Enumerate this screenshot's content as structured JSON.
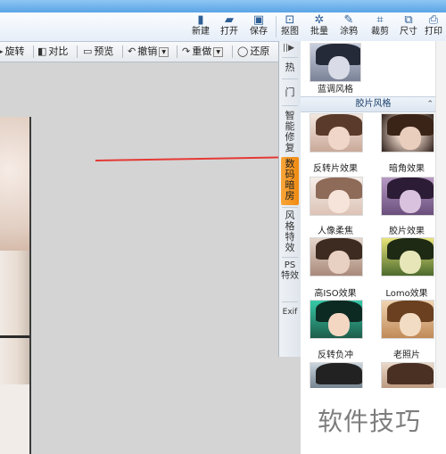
{
  "toolbar": {
    "items": [
      {
        "label": "新建",
        "icon": "new-file-icon",
        "glyph": "▮"
      },
      {
        "label": "打开",
        "icon": "folder-open-icon",
        "glyph": "▰"
      },
      {
        "label": "保存",
        "icon": "save-icon",
        "glyph": "▣"
      },
      {
        "label": "抠图",
        "icon": "cutout-icon",
        "glyph": "⊡"
      },
      {
        "label": "批量",
        "icon": "batch-gear-icon",
        "glyph": "✲"
      },
      {
        "label": "涂鸦",
        "icon": "doodle-icon",
        "glyph": "✎"
      },
      {
        "label": "裁剪",
        "icon": "crop-icon",
        "glyph": "⌗"
      },
      {
        "label": "尺寸",
        "icon": "resize-icon",
        "glyph": "⧉"
      },
      {
        "label": "打印",
        "icon": "print-icon",
        "glyph": "⎙"
      }
    ]
  },
  "edit_toolbar": {
    "rotate": "旋转",
    "compare": "对比",
    "preview": "预览",
    "undo": "撤销",
    "redo": "重做",
    "restore": "还原"
  },
  "side_tabs": {
    "collapse": "||▶",
    "hot": "热",
    "door": "门",
    "smart_retouch": "智能修复",
    "digital_darkroom": "数码暗房",
    "style_effects": "风格特效",
    "ps_effects": "PS特效",
    "exif": "Exif"
  },
  "effects_panel": {
    "top_item": "蓝调风格",
    "section_title": "胶片风格",
    "items": [
      {
        "label": "反转片效果",
        "style": "warm"
      },
      {
        "label": "暗角效果",
        "style": "vignette"
      },
      {
        "label": "人像柔焦",
        "style": "soft"
      },
      {
        "label": "胶片效果",
        "style": "film"
      },
      {
        "label": "高ISO效果",
        "style": "iso"
      },
      {
        "label": "Lomo效果",
        "style": "lomo"
      },
      {
        "label": "反转负冲",
        "style": "cross"
      },
      {
        "label": "老照片",
        "style": "old"
      }
    ]
  },
  "watermark": "软件技巧",
  "colors": {
    "active_tab": "#f08b12",
    "arrow": "#e53935",
    "section_header_text": "#1a3f6b"
  }
}
